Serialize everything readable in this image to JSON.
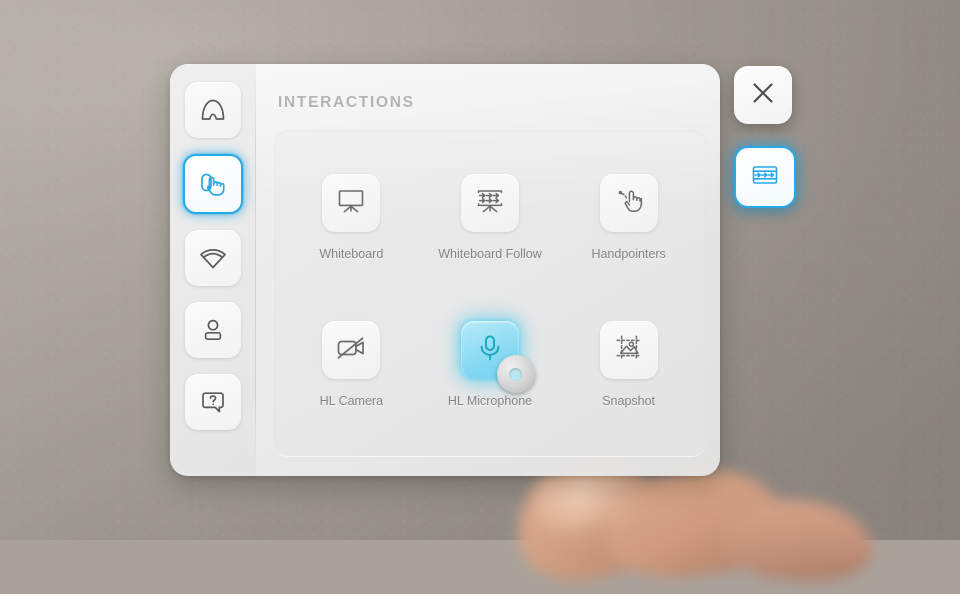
{
  "app": {
    "panel_title": "INTERACTIONS",
    "accent_color": "#29a8e8",
    "selected_tile_color": "#8fdcf3",
    "label_color": "#848484"
  },
  "sidebar": {
    "items": [
      {
        "id": "home",
        "icon": "arch-home-icon",
        "label": "Home",
        "active": false
      },
      {
        "id": "interactions",
        "icon": "hand-tap-icon",
        "label": "Interactions",
        "active": true
      },
      {
        "id": "network",
        "icon": "wifi-icon",
        "label": "Network",
        "active": false
      },
      {
        "id": "profile",
        "icon": "person-icon",
        "label": "Profile",
        "active": false
      },
      {
        "id": "help",
        "icon": "question-chat-icon",
        "label": "Help",
        "active": false
      }
    ]
  },
  "main": {
    "rows": [
      [
        {
          "id": "whiteboard",
          "label": "Whiteboard",
          "icon": "whiteboard-icon",
          "selected": false
        },
        {
          "id": "whiteboard-follow",
          "label": "Whiteboard Follow",
          "icon": "whiteboard-follow-icon",
          "selected": false
        },
        {
          "id": "handpointers",
          "label": "Handpointers",
          "icon": "handpointer-icon",
          "selected": false
        }
      ],
      [
        {
          "id": "hl-camera",
          "label": "HL Camera",
          "icon": "camera-off-icon",
          "selected": false
        },
        {
          "id": "hl-microphone",
          "label": "HL Microphone",
          "icon": "microphone-icon",
          "selected": true
        },
        {
          "id": "snapshot",
          "label": "Snapshot",
          "icon": "snapshot-icon",
          "selected": false
        }
      ]
    ]
  },
  "floating_buttons": [
    {
      "id": "close",
      "icon": "close-x-icon",
      "label": "Close",
      "active": false
    },
    {
      "id": "panel",
      "icon": "panel-menu-icon",
      "label": "Toggle Panel",
      "active": true
    }
  ]
}
